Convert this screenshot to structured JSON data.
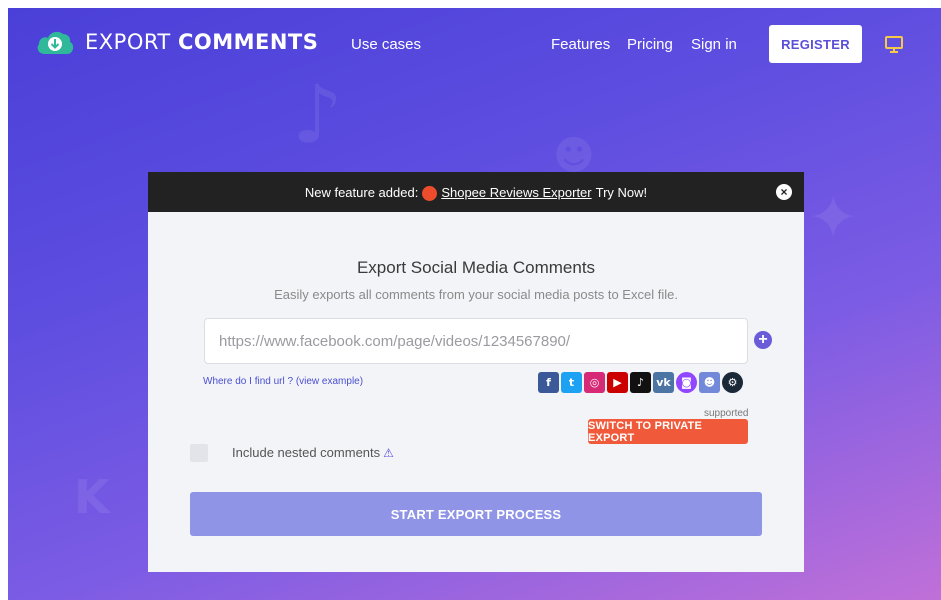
{
  "header": {
    "logo_word1": "EXPORT",
    "logo_word2": "COMMENTS",
    "nav": {
      "use_cases": "Use cases",
      "features": "Features",
      "pricing": "Pricing",
      "sign_in": "Sign in"
    },
    "register_label": "REGISTER"
  },
  "banner": {
    "prefix": "New feature added:",
    "link": "Shopee Reviews Exporter",
    "suffix": "Try Now!",
    "close_glyph": "×"
  },
  "card": {
    "title": "Export Social Media Comments",
    "subtitle": "Easily exports all comments from your social media posts to Excel file.",
    "url_placeholder": "https://www.facebook.com/page/videos/1234567890/",
    "url_value": "",
    "add_glyph": "+",
    "help_link": "Where do I find url ? (view example)",
    "supported_label": "supported",
    "private_export_label": "SWITCH TO PRIVATE EXPORT",
    "nested_label": "Include nested comments",
    "nested_checked": false,
    "start_label": "START EXPORT PROCESS"
  },
  "social_icons": [
    {
      "name": "facebook-icon",
      "glyph": "f",
      "color": "#3b5998"
    },
    {
      "name": "twitter-icon",
      "glyph": "t",
      "color": "#1da1f2"
    },
    {
      "name": "instagram-icon",
      "glyph": "◎",
      "color": "#d62976"
    },
    {
      "name": "youtube-icon",
      "glyph": "▶",
      "color": "#cc0000"
    },
    {
      "name": "tiktok-icon",
      "glyph": "♪",
      "color": "#111111"
    },
    {
      "name": "vk-icon",
      "glyph": "vk",
      "color": "#4c75a3"
    },
    {
      "name": "twitch-icon",
      "glyph": "◙",
      "color": "#9146ff"
    },
    {
      "name": "discord-icon",
      "glyph": "☻",
      "color": "#7289da"
    },
    {
      "name": "steam-icon",
      "glyph": "⚙",
      "color": "#1b2838"
    }
  ],
  "colors": {
    "brand": "#5a4fd8",
    "accent_orange": "#f05a3a",
    "start_button": "#8f94e6"
  }
}
